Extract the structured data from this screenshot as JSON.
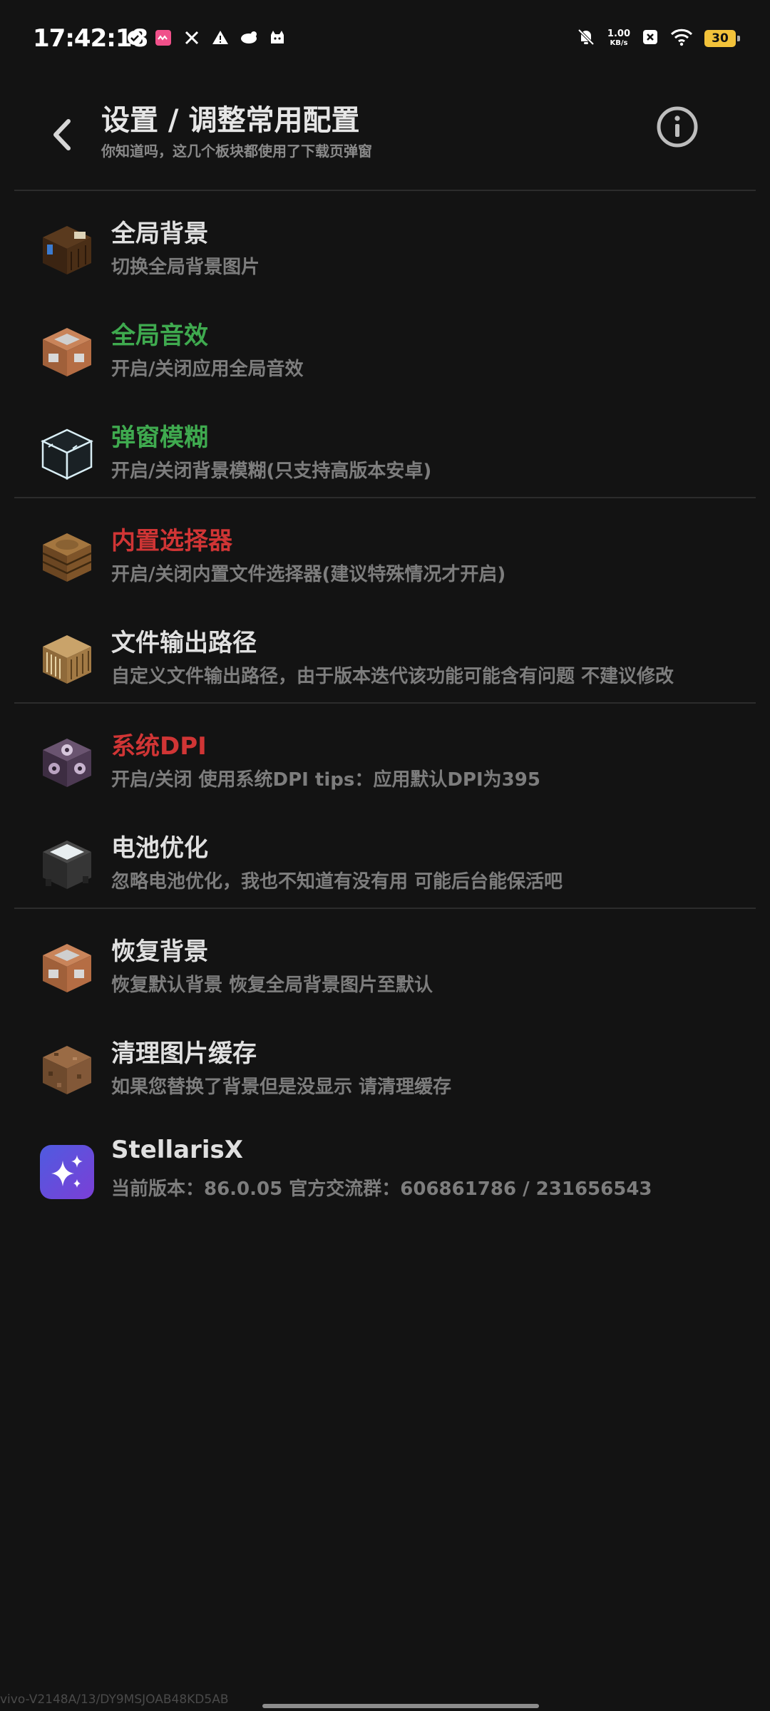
{
  "status_bar": {
    "time": "17:42:18",
    "net_speed_value": "1.00",
    "net_speed_unit": "KB/s",
    "battery_level": "30",
    "left_icons": [
      "check-circle-icon",
      "app-icon",
      "tools-icon",
      "warning-icon",
      "dog-icon",
      "cat-icon"
    ],
    "right_icons": [
      "bell-off-icon",
      "network-speed",
      "close-box-icon",
      "wifi-icon",
      "battery-icon"
    ]
  },
  "header": {
    "title": "设置 / 调整常用配置",
    "subtitle": "你知道吗，这几个板块都使用了下载页弹窗"
  },
  "items": [
    {
      "title": "全局背景",
      "desc": "切换全局背景图片",
      "color": "#e0e0e0",
      "icon": "bookshelf-block-icon"
    },
    {
      "title": "全局音效",
      "desc": "开启/关闭应用全局音效",
      "color": "#3faa4f",
      "icon": "command-block-icon"
    },
    {
      "title": "弹窗模糊",
      "desc": "开启/关闭背景模糊(只支持高版本安卓)",
      "color": "#3faa4f",
      "icon": "glass-block-icon"
    },
    {
      "title": "内置选择器",
      "desc": "开启/关闭内置文件选择器(建议特殊情况才开启)",
      "color": "#d03535",
      "icon": "barrel-block-icon"
    },
    {
      "title": "文件输出路径",
      "desc": "自定义文件输出路径，由于版本迭代该功能可能含有问题 不建议修改",
      "color": "#e0e0e0",
      "icon": "loom-block-icon"
    },
    {
      "title": "系统DPI",
      "desc": "开启/关闭 使用系统DPI tips：应用默认DPI为395",
      "color": "#d03535",
      "icon": "chorus-block-icon"
    },
    {
      "title": "电池优化",
      "desc": "忽略电池优化，我也不知道有没有用 可能后台能保活吧",
      "color": "#e0e0e0",
      "icon": "cauldron-block-icon"
    },
    {
      "title": "恢复背景",
      "desc": "恢复默认背景 恢复全局背景图片至默认",
      "color": "#e0e0e0",
      "icon": "command-block-icon"
    },
    {
      "title": "清理图片缓存",
      "desc": "如果您替换了背景但是没显示 请清理缓存",
      "color": "#e0e0e0",
      "icon": "dirt-block-icon"
    },
    {
      "title": "StellarisX",
      "desc": "当前版本：86.0.05 官方交流群：606861786 / 231656543",
      "color": "#e0e0e0",
      "icon": "sparkle-app-icon"
    }
  ],
  "footer": {
    "device_label": "vivo-V2148A/13/DY9MSJOAB48KD5AB"
  },
  "colors": {
    "background": "#131313",
    "green": "#3faa4f",
    "red": "#d03535",
    "battery": "#f2c23a"
  }
}
